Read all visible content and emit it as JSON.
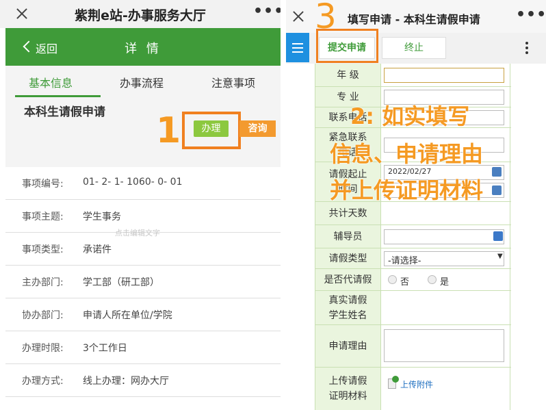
{
  "left": {
    "window_title": "紫荆e站-办事服务大厅",
    "header": {
      "back_label": "返回",
      "title": "详 情"
    },
    "tabs": [
      "基本信息",
      "办事流程",
      "注意事项"
    ],
    "item_name": "本科生请假申请",
    "btn_handle": "办理",
    "btn_consult": "咨询",
    "annotation_1": "1",
    "watermark": "点击编辑文字",
    "rows": [
      {
        "k": "事项编号:",
        "v": "01- 2- 1- 1060- 0- 01"
      },
      {
        "k": "事项主题:",
        "v": "学生事务"
      },
      {
        "k": "事项类型:",
        "v": "承诺件"
      },
      {
        "k": "主办部门:",
        "v": "学工部（研工部）"
      },
      {
        "k": "协办部门:",
        "v": "申请人所在单位/学院"
      },
      {
        "k": "办理时限:",
        "v": "3个工作日"
      },
      {
        "k": "办理方式:",
        "v": "线上办理：网办大厅"
      }
    ]
  },
  "right": {
    "window_title": "填写申请 - 本科生请假申请",
    "toolbar": {
      "submit": "提交申请",
      "stop": "终止"
    },
    "annotation_3": "3",
    "annotation_2": [
      "2:  如实填写",
      "信息、申请理由",
      "并上传证明材料"
    ],
    "form": {
      "grade": "年 级",
      "major": "专 业",
      "phone": "联系电话",
      "emergency": "紧急联系电话",
      "leave_dates": "请假起止时间",
      "date_value": "2022/02/27",
      "total_days": "共计天数",
      "counselor": "辅导员",
      "leave_type": "请假类型",
      "leave_type_value": "-请选择-",
      "proxy": "是否代请假",
      "proxy_no": "否",
      "proxy_yes": "是",
      "real_name": "真实请假学生姓名",
      "reason": "申请理由",
      "upload": "上传请假证明材料",
      "upload_btn": "上传附件"
    }
  },
  "colors": {
    "green": "#3f9b39",
    "orange": "#f59a23",
    "blue": "#1e90e0",
    "light_green": "#8cc83f"
  }
}
